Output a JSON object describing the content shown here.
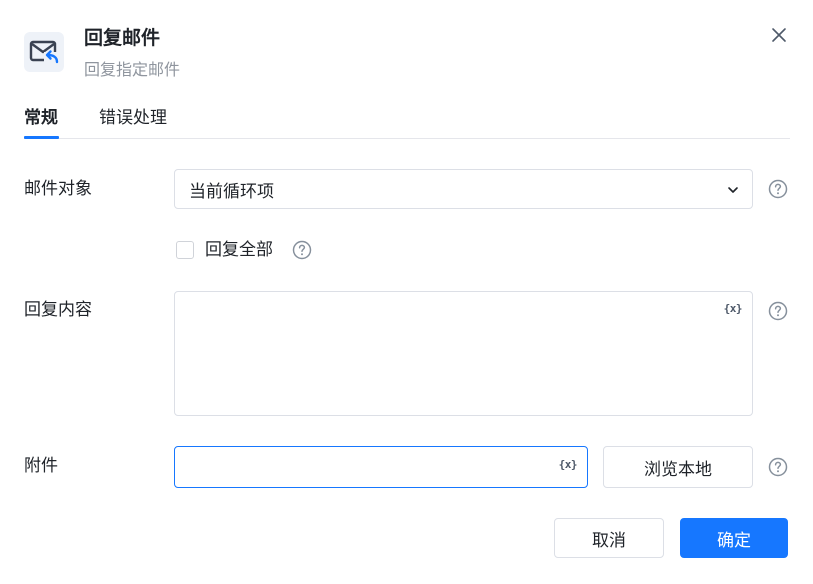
{
  "dialog": {
    "title": "回复邮件",
    "subtitle": "回复指定邮件",
    "icon": "mail-reply-icon",
    "close_icon": "close-icon"
  },
  "tabs": [
    {
      "label": "常规",
      "active": true
    },
    {
      "label": "错误处理",
      "active": false
    }
  ],
  "form": {
    "mail_object": {
      "label": "邮件对象",
      "value": "当前循环项"
    },
    "reply_all": {
      "label": "回复全部",
      "checked": false
    },
    "reply_content": {
      "label": "回复内容",
      "value": "",
      "var_button": "{x}"
    },
    "attachment": {
      "label": "附件",
      "value": "",
      "var_button": "{x}",
      "browse_label": "浏览本地"
    }
  },
  "footer": {
    "cancel_label": "取消",
    "ok_label": "确定"
  },
  "colors": {
    "accent": "#1677ff",
    "text": "#1f2329",
    "muted": "#8f959e",
    "border": "#dcdfe6"
  }
}
